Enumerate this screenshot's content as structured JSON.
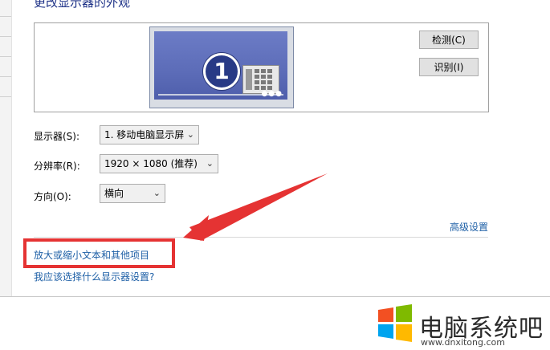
{
  "page": {
    "title": "更改显示器的外观"
  },
  "preview": {
    "monitor_number": "1"
  },
  "buttons": {
    "detect": "检测(C)",
    "identify": "识别(I)"
  },
  "settings": {
    "display": {
      "label": "显示器(S):",
      "value": "1. 移动电脑显示屏"
    },
    "resolution": {
      "label": "分辨率(R):",
      "value": "1920 × 1080 (推荐)"
    },
    "orientation": {
      "label": "方向(O):",
      "value": "横向"
    }
  },
  "links": {
    "advanced": "高级设置",
    "text_size": "放大或缩小文本和其他项目",
    "which_settings": "我应该选择什么显示器设置?"
  },
  "annotation": {
    "color": "#e53333"
  },
  "watermark": {
    "title": "电脑系统吧",
    "url": "www.dnxitong.com"
  },
  "colors": {
    "link": "#1d5fa6",
    "title": "#1e3287"
  }
}
